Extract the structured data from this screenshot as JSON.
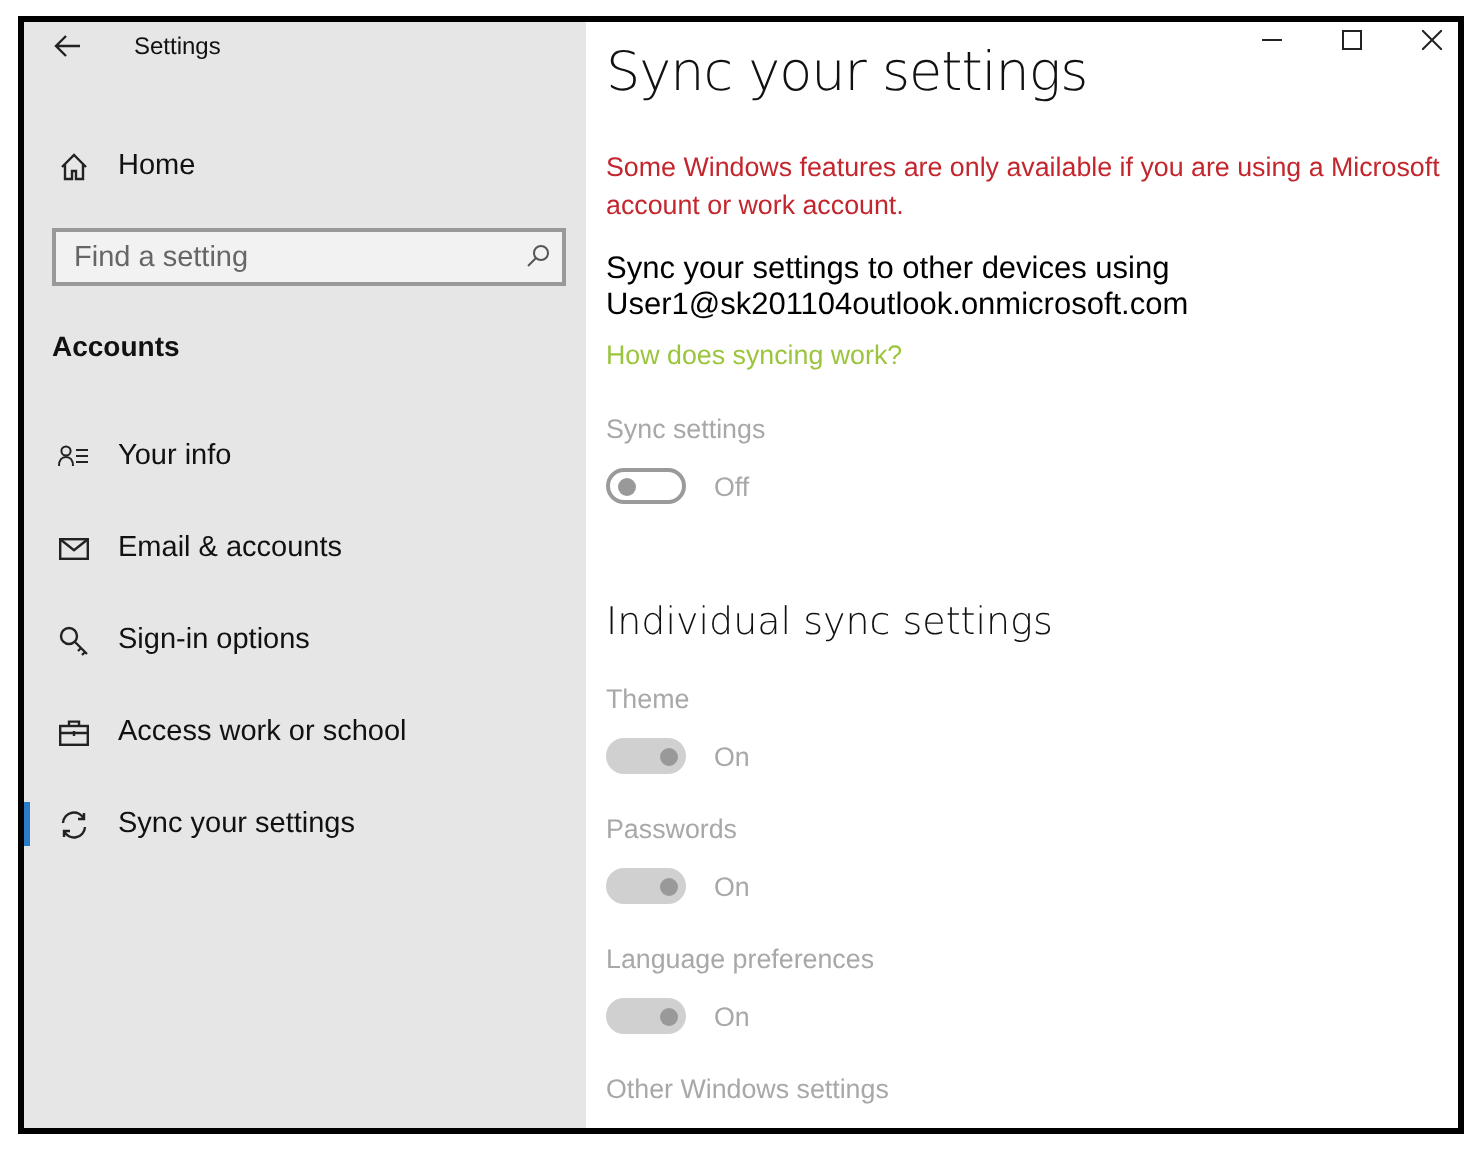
{
  "window": {
    "title": "Settings"
  },
  "sidebar": {
    "home": "Home",
    "search": {
      "placeholder": "Find a setting"
    },
    "section": "Accounts",
    "items": [
      {
        "label": "Your info",
        "selected": false
      },
      {
        "label": "Email & accounts",
        "selected": false
      },
      {
        "label": "Sign-in options",
        "selected": false
      },
      {
        "label": "Access work or school",
        "selected": false
      },
      {
        "label": "Sync your settings",
        "selected": true
      }
    ]
  },
  "main": {
    "title": "Sync your settings",
    "warning": "Some Windows features are only available if you are using a Microsoft account or work account.",
    "description": "Sync your settings to other devices using User1@sk201104outlook.onmicrosoft.com",
    "link": "How does syncing work?",
    "sync": {
      "label": "Sync settings",
      "on": false,
      "disabled": true,
      "state_label": "Off"
    },
    "section_title": "Individual sync settings",
    "settings": [
      {
        "kind": "toggle",
        "label": "Theme",
        "on": true,
        "disabled": true,
        "state_label": "On"
      },
      {
        "kind": "toggle",
        "label": "Passwords",
        "on": true,
        "disabled": true,
        "state_label": "On"
      },
      {
        "kind": "toggle",
        "label": "Language preferences",
        "on": true,
        "disabled": true,
        "state_label": "On"
      },
      {
        "kind": "label",
        "label": "Other Windows settings"
      }
    ]
  }
}
